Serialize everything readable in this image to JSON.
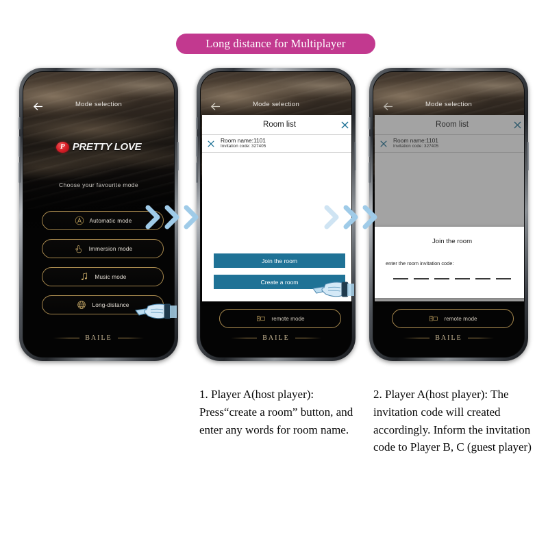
{
  "banner": {
    "title": "Long distance for Multiplayer",
    "color": "#c2398f"
  },
  "app": {
    "nav_title": "Mode selection",
    "back_icon": "back-arrow-icon",
    "brand_mark": "P",
    "brand_name": "PRETTY LOVE",
    "choose_label": "Choose your favourite mode",
    "footer_brand": "BAILE",
    "modes": [
      {
        "label": "Automatic mode",
        "icon": "automatic-mode-icon"
      },
      {
        "label": "Immersion mode",
        "icon": "hand-touch-icon"
      },
      {
        "label": "Music mode",
        "icon": "music-note-icon"
      },
      {
        "label": "Long-distance",
        "icon": "globe-icon"
      }
    ],
    "remote_mode_label": "remote mode",
    "remote_mode_icon": "remote-device-icon"
  },
  "room_dialog": {
    "title": "Room list",
    "close_icon": "close-x-icon",
    "rows": [
      {
        "name": "Room name:1101",
        "code": "Invitation code:  327405",
        "close_icon": "close-x-icon"
      }
    ],
    "buttons": [
      {
        "label": "Join the room"
      },
      {
        "label": "Create a room"
      }
    ],
    "button_color": "#1f7296"
  },
  "join_overlay": {
    "title": "Join the room",
    "subtitle": "enter the room invitation code:",
    "slot_count": 6
  },
  "arrows": {
    "icon": "chevron-right-icon",
    "color": "#9fcbe8",
    "count_per_group": 3
  },
  "cursors": {
    "icon": "pointing-hand-cursor",
    "color": "#a8d4ec"
  },
  "captions": {
    "step_1": "1. Player A(host player): Press“create a room” button, and enter any words for room name.",
    "step_2": "2. Player A(host player): The invitation code will created accordingly. Inform the invitation code to Player B, C (guest player)"
  }
}
